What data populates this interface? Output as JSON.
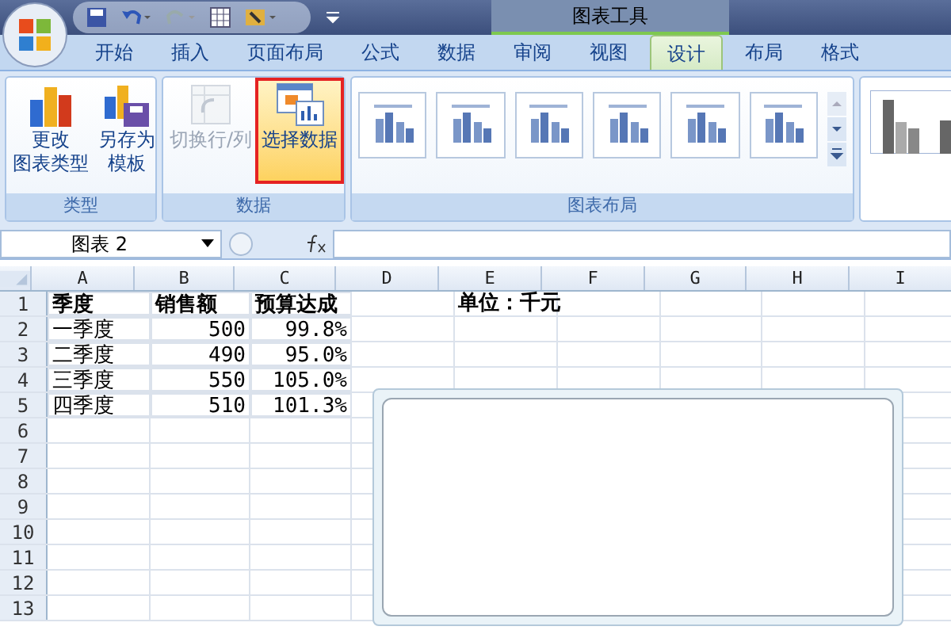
{
  "window": {
    "title": "图表工具"
  },
  "tabs": [
    {
      "label": "开始",
      "selected": false
    },
    {
      "label": "插入",
      "selected": false
    },
    {
      "label": "页面布局",
      "selected": false
    },
    {
      "label": "公式",
      "selected": false
    },
    {
      "label": "数据",
      "selected": false
    },
    {
      "label": "审阅",
      "selected": false
    },
    {
      "label": "视图",
      "selected": false
    },
    {
      "label": "设计",
      "selected": true
    },
    {
      "label": "布局",
      "selected": false
    },
    {
      "label": "格式",
      "selected": false
    }
  ],
  "ribbon_groups": [
    {
      "label": "类型",
      "kind": "buttons",
      "buttons": [
        {
          "lines": [
            "更改",
            "图表类型"
          ],
          "kind": "chart",
          "disabled": false,
          "highlighted": false
        },
        {
          "lines": [
            "另存为",
            "模板"
          ],
          "kind": "save-chart",
          "disabled": false,
          "highlighted": false
        }
      ]
    },
    {
      "label": "数据",
      "kind": "buttons",
      "buttons": [
        {
          "lines": [
            "切换行/列"
          ],
          "kind": "switch",
          "disabled": true,
          "highlighted": false
        },
        {
          "lines": [
            "选择数据"
          ],
          "kind": "select",
          "disabled": false,
          "highlighted": true
        }
      ]
    },
    {
      "label": "图表布局",
      "kind": "gallery"
    }
  ],
  "name_box": {
    "value": "图表 2"
  },
  "columns": [
    "A",
    "B",
    "C",
    "D",
    "E",
    "F",
    "G",
    "H",
    "I"
  ],
  "table": {
    "header": [
      "季度",
      "销售额",
      "预算达成"
    ],
    "rows": [
      [
        "一季度",
        "500",
        "99.8%"
      ],
      [
        "二季度",
        "490",
        "95.0%"
      ],
      [
        "三季度",
        "550",
        "105.0%"
      ],
      [
        "四季度",
        "510",
        "101.3%"
      ]
    ]
  },
  "unit_label": "单位：千元",
  "row_numbers": [
    "1",
    "2",
    "3",
    "4",
    "5",
    "6",
    "7",
    "8",
    "9",
    "10",
    "11",
    "12",
    "13"
  ]
}
